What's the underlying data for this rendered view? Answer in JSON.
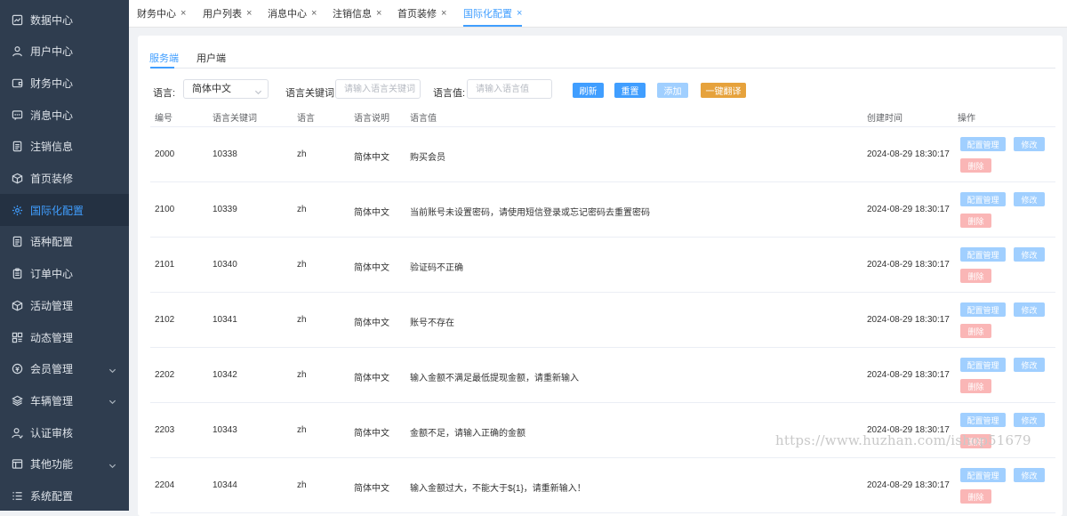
{
  "sidebar": {
    "items": [
      {
        "label": "数据中心",
        "icon": "chart-icon",
        "active": false,
        "chevron": false
      },
      {
        "label": "用户中心",
        "icon": "user-icon",
        "active": false,
        "chevron": false
      },
      {
        "label": "财务中心",
        "icon": "wallet-icon",
        "active": false,
        "chevron": false
      },
      {
        "label": "消息中心",
        "icon": "message-icon",
        "active": false,
        "chevron": false
      },
      {
        "label": "注销信息",
        "icon": "document-icon",
        "active": false,
        "chevron": false
      },
      {
        "label": "首页装修",
        "icon": "box-icon",
        "active": false,
        "chevron": false
      },
      {
        "label": "国际化配置",
        "icon": "gear-icon",
        "active": true,
        "chevron": false
      },
      {
        "label": "语种配置",
        "icon": "document-icon",
        "active": false,
        "chevron": false
      },
      {
        "label": "订单中心",
        "icon": "clipboard-icon",
        "active": false,
        "chevron": false
      },
      {
        "label": "活动管理",
        "icon": "box-icon",
        "active": false,
        "chevron": false
      },
      {
        "label": "动态管理",
        "icon": "grid-icon",
        "active": false,
        "chevron": false
      },
      {
        "label": "会员管理",
        "icon": "coin-icon",
        "active": false,
        "chevron": true
      },
      {
        "label": "车辆管理",
        "icon": "layers-icon",
        "active": false,
        "chevron": true
      },
      {
        "label": "认证审核",
        "icon": "user-check-icon",
        "active": false,
        "chevron": false
      },
      {
        "label": "其他功能",
        "icon": "window-icon",
        "active": false,
        "chevron": true
      },
      {
        "label": "系统配置",
        "icon": "list-icon",
        "active": false,
        "chevron": false
      }
    ]
  },
  "tabs": [
    {
      "label": "财务中心",
      "active": false
    },
    {
      "label": "用户列表",
      "active": false
    },
    {
      "label": "消息中心",
      "active": false
    },
    {
      "label": "注销信息",
      "active": false
    },
    {
      "label": "首页装修",
      "active": false
    },
    {
      "label": "国际化配置",
      "active": true
    }
  ],
  "tab_close_glyph": "×",
  "subtabs": [
    {
      "label": "服务端",
      "active": true
    },
    {
      "label": "用户端",
      "active": false
    }
  ],
  "filters": {
    "language_label": "语言:",
    "language_value": "简体中文",
    "keyword_label": "语言关键词:",
    "keyword_placeholder": "请输入语言关键词",
    "value_label": "语言值:",
    "value_placeholder": "请输入语言值"
  },
  "buttons": {
    "refresh": "刷新",
    "reset": "重置",
    "add": "添加",
    "translate": "一键翻译"
  },
  "colors": {
    "primary": "#409eff",
    "primary_light": "#a0cfff",
    "danger_light": "#fab6b6",
    "warning": "#e6a23c",
    "sidebar_bg": "#2f3d4f"
  },
  "table": {
    "headers": [
      "编号",
      "语言关键词",
      "语言",
      "语言说明",
      "语言值",
      "创建时间",
      "操作"
    ],
    "rows": [
      {
        "id": "2000",
        "key": "10338",
        "lang": "zh",
        "desc": "简体中文",
        "value": "购买会员",
        "created": "2024-08-29 18:30:17"
      },
      {
        "id": "2100",
        "key": "10339",
        "lang": "zh",
        "desc": "简体中文",
        "value": "当前账号未设置密码，请使用短信登录或忘记密码去重置密码",
        "created": "2024-08-29 18:30:17"
      },
      {
        "id": "2101",
        "key": "10340",
        "lang": "zh",
        "desc": "简体中文",
        "value": "验证码不正确",
        "created": "2024-08-29 18:30:17"
      },
      {
        "id": "2102",
        "key": "10341",
        "lang": "zh",
        "desc": "简体中文",
        "value": "账号不存在",
        "created": "2024-08-29 18:30:17"
      },
      {
        "id": "2202",
        "key": "10342",
        "lang": "zh",
        "desc": "简体中文",
        "value": "输入金额不满足最低提现金额，请重新输入",
        "created": "2024-08-29 18:30:17"
      },
      {
        "id": "2203",
        "key": "10343",
        "lang": "zh",
        "desc": "简体中文",
        "value": "金额不足，请输入正确的金额",
        "created": "2024-08-29 18:30:17"
      },
      {
        "id": "2204",
        "key": "10344",
        "lang": "zh",
        "desc": "简体中文",
        "value": "输入金额过大，不能大于${1}，请重新输入！",
        "created": "2024-08-29 18:30:17"
      }
    ],
    "actions": {
      "config": "配置管理",
      "edit": "修改",
      "delete": "删除"
    }
  },
  "watermark": "https://www.huzhan.com/ishop51679"
}
